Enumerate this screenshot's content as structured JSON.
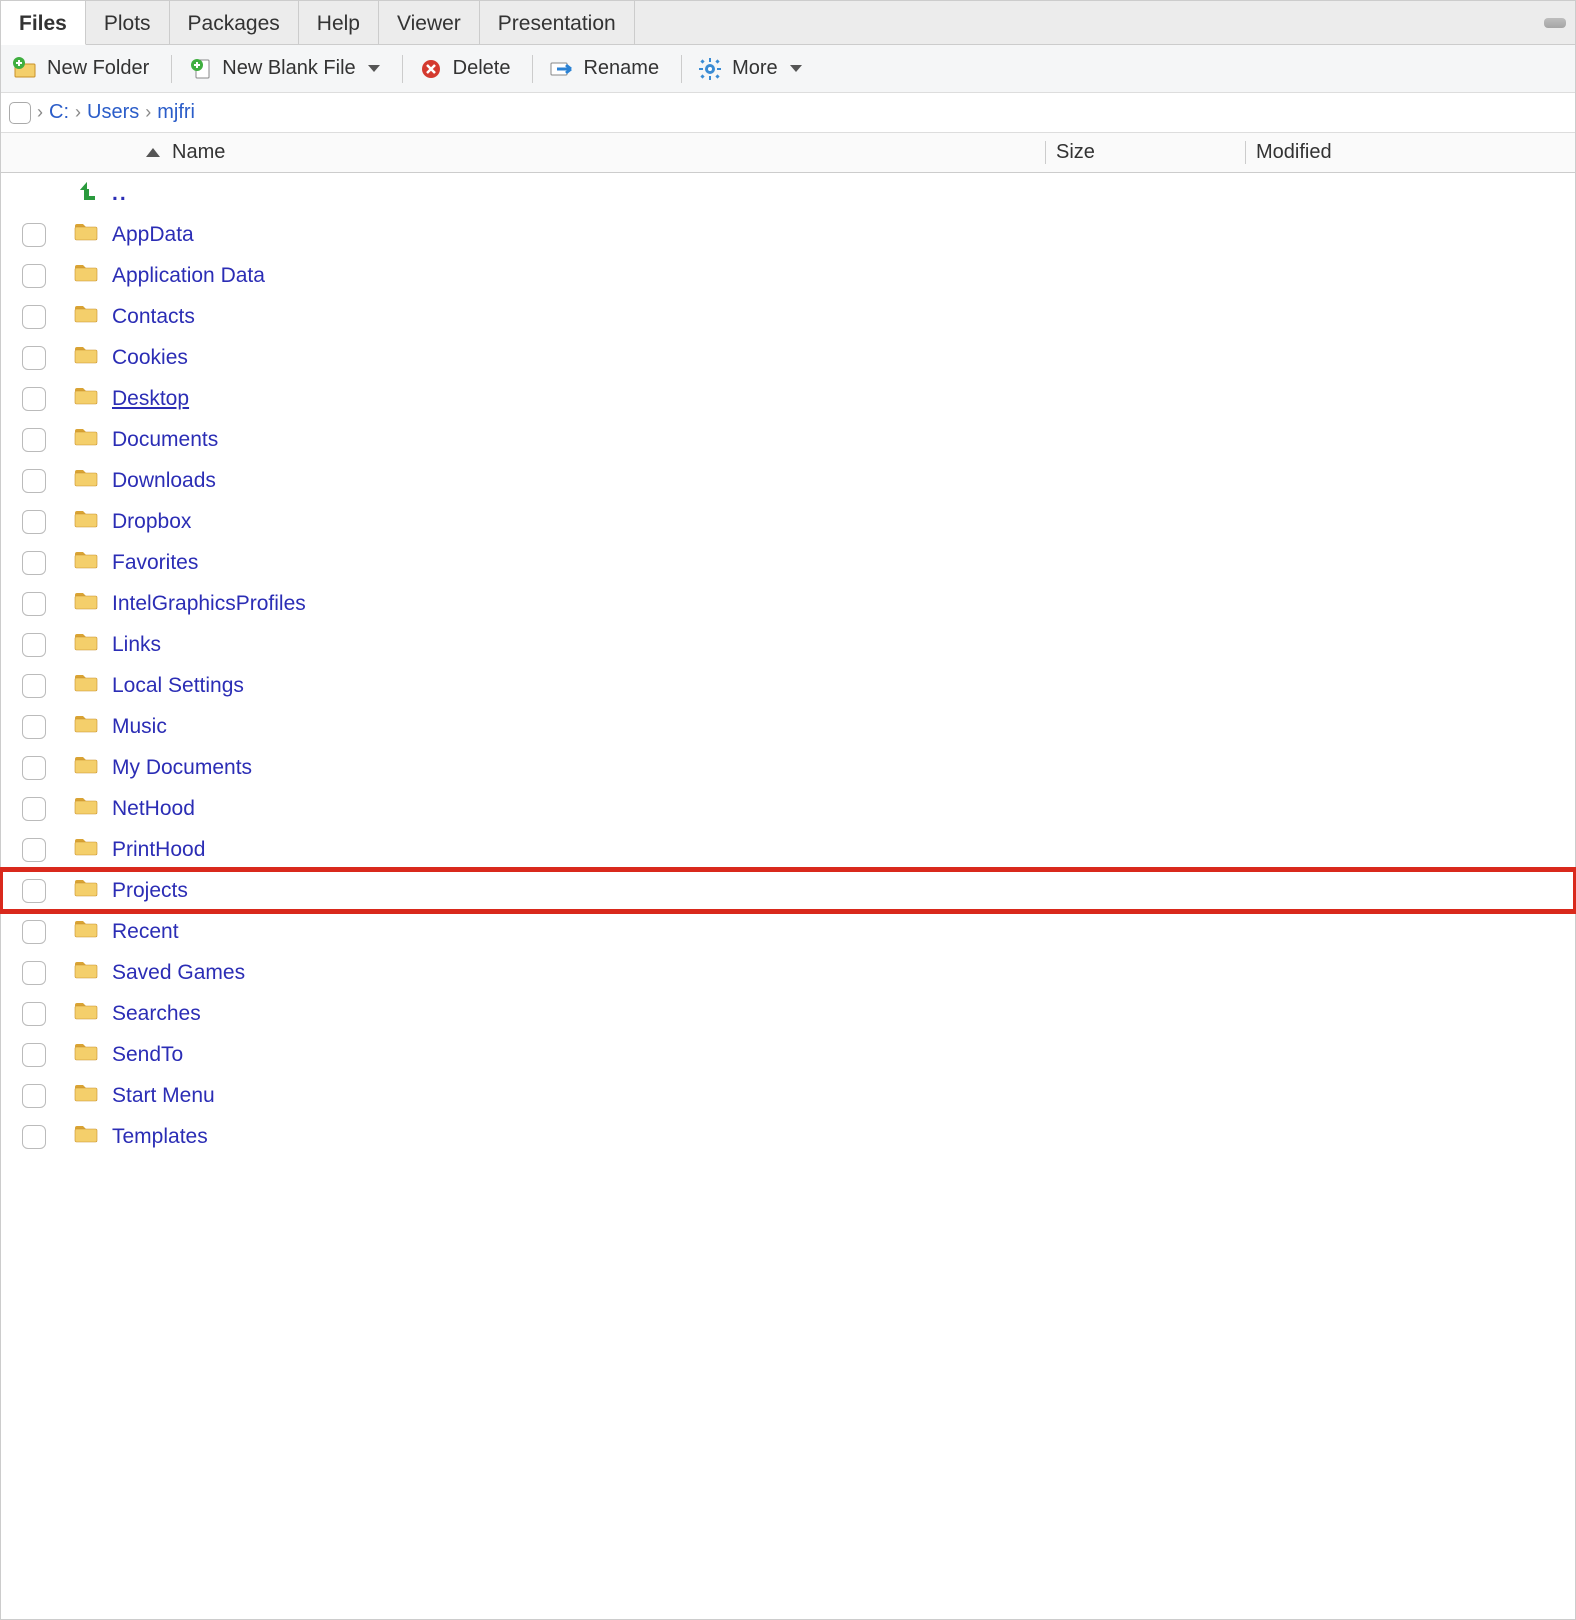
{
  "tabs": [
    {
      "label": "Files",
      "active": true
    },
    {
      "label": "Plots",
      "active": false
    },
    {
      "label": "Packages",
      "active": false
    },
    {
      "label": "Help",
      "active": false
    },
    {
      "label": "Viewer",
      "active": false
    },
    {
      "label": "Presentation",
      "active": false
    }
  ],
  "toolbar": {
    "new_folder": "New Folder",
    "new_blank_file": "New Blank File",
    "delete": "Delete",
    "rename": "Rename",
    "more": "More"
  },
  "breadcrumb": [
    {
      "label": "C:"
    },
    {
      "label": "Users"
    },
    {
      "label": "mjfri"
    }
  ],
  "columns": {
    "name": "Name",
    "size": "Size",
    "modified": "Modified"
  },
  "parent_dir_label": "..",
  "rows": [
    {
      "name": "AppData",
      "size": "",
      "modified": "",
      "underlined": false,
      "highlighted": false
    },
    {
      "name": "Application Data",
      "size": "",
      "modified": "",
      "underlined": false,
      "highlighted": false
    },
    {
      "name": "Contacts",
      "size": "",
      "modified": "",
      "underlined": false,
      "highlighted": false
    },
    {
      "name": "Cookies",
      "size": "",
      "modified": "",
      "underlined": false,
      "highlighted": false
    },
    {
      "name": "Desktop",
      "size": "",
      "modified": "",
      "underlined": true,
      "highlighted": false
    },
    {
      "name": "Documents",
      "size": "",
      "modified": "",
      "underlined": false,
      "highlighted": false
    },
    {
      "name": "Downloads",
      "size": "",
      "modified": "",
      "underlined": false,
      "highlighted": false
    },
    {
      "name": "Dropbox",
      "size": "",
      "modified": "",
      "underlined": false,
      "highlighted": false
    },
    {
      "name": "Favorites",
      "size": "",
      "modified": "",
      "underlined": false,
      "highlighted": false
    },
    {
      "name": "IntelGraphicsProfiles",
      "size": "",
      "modified": "",
      "underlined": false,
      "highlighted": false
    },
    {
      "name": "Links",
      "size": "",
      "modified": "",
      "underlined": false,
      "highlighted": false
    },
    {
      "name": "Local Settings",
      "size": "",
      "modified": "",
      "underlined": false,
      "highlighted": false
    },
    {
      "name": "Music",
      "size": "",
      "modified": "",
      "underlined": false,
      "highlighted": false
    },
    {
      "name": "My Documents",
      "size": "",
      "modified": "",
      "underlined": false,
      "highlighted": false
    },
    {
      "name": "NetHood",
      "size": "",
      "modified": "",
      "underlined": false,
      "highlighted": false
    },
    {
      "name": "PrintHood",
      "size": "",
      "modified": "",
      "underlined": false,
      "highlighted": false
    },
    {
      "name": "Projects",
      "size": "",
      "modified": "",
      "underlined": false,
      "highlighted": true
    },
    {
      "name": "Recent",
      "size": "",
      "modified": "",
      "underlined": false,
      "highlighted": false
    },
    {
      "name": "Saved Games",
      "size": "",
      "modified": "",
      "underlined": false,
      "highlighted": false
    },
    {
      "name": "Searches",
      "size": "",
      "modified": "",
      "underlined": false,
      "highlighted": false
    },
    {
      "name": "SendTo",
      "size": "",
      "modified": "",
      "underlined": false,
      "highlighted": false
    },
    {
      "name": "Start Menu",
      "size": "",
      "modified": "",
      "underlined": false,
      "highlighted": false
    },
    {
      "name": "Templates",
      "size": "",
      "modified": "",
      "underlined": false,
      "highlighted": false
    }
  ]
}
